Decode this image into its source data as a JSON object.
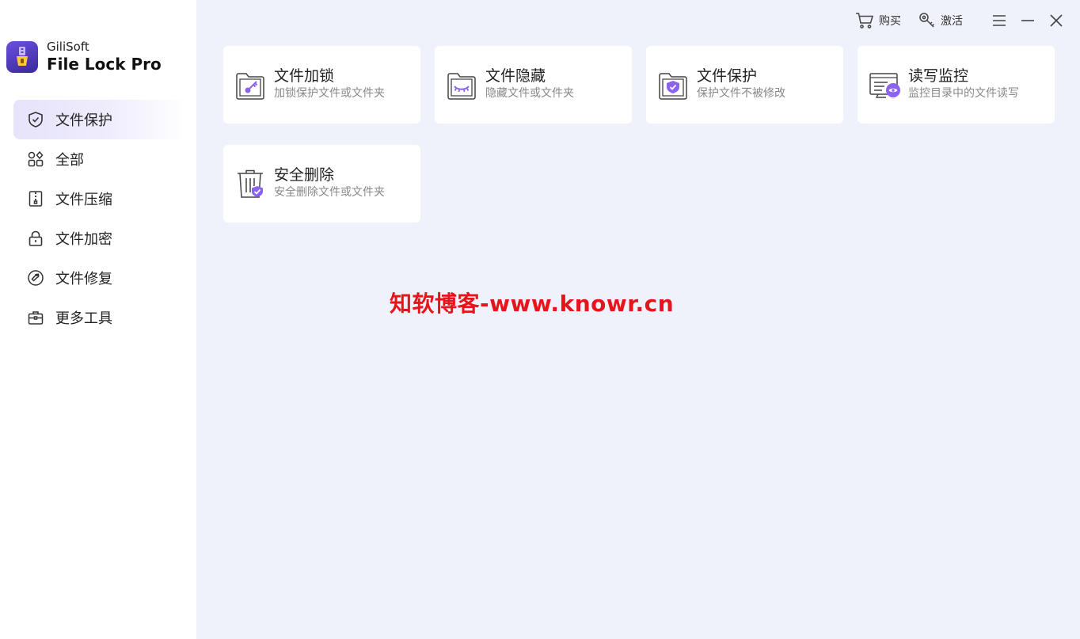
{
  "brand": {
    "company": "GiliSoft",
    "product": "File Lock Pro"
  },
  "nav": {
    "items": [
      {
        "label": "文件保护",
        "icon": "shield-icon",
        "active": true
      },
      {
        "label": "全部",
        "icon": "grid-icon",
        "active": false
      },
      {
        "label": "文件压缩",
        "icon": "zip-file-icon",
        "active": false
      },
      {
        "label": "文件加密",
        "icon": "lock-icon",
        "active": false
      },
      {
        "label": "文件修复",
        "icon": "repair-icon",
        "active": false
      },
      {
        "label": "更多工具",
        "icon": "toolbox-icon",
        "active": false
      }
    ]
  },
  "topbar": {
    "buy_label": "购买",
    "activate_label": "激活"
  },
  "cards": [
    {
      "title": "文件加锁",
      "desc": "加锁保护文件或文件夹",
      "icon": "file-key-icon"
    },
    {
      "title": "文件隐藏",
      "desc": "隐藏文件或文件夹",
      "icon": "file-hidden-icon"
    },
    {
      "title": "文件保护",
      "desc": "保护文件不被修改",
      "icon": "file-shield-icon"
    },
    {
      "title": "读写监控",
      "desc": "监控目录中的文件读写",
      "icon": "monitor-eye-icon"
    },
    {
      "title": "安全删除",
      "desc": "安全删除文件或文件夹",
      "icon": "trash-check-icon"
    }
  ],
  "watermark": "知软博客-www.knowr.cn",
  "colors": {
    "accent": "#8a63f0",
    "background": "#eff2fb",
    "watermark": "#e8141c"
  }
}
